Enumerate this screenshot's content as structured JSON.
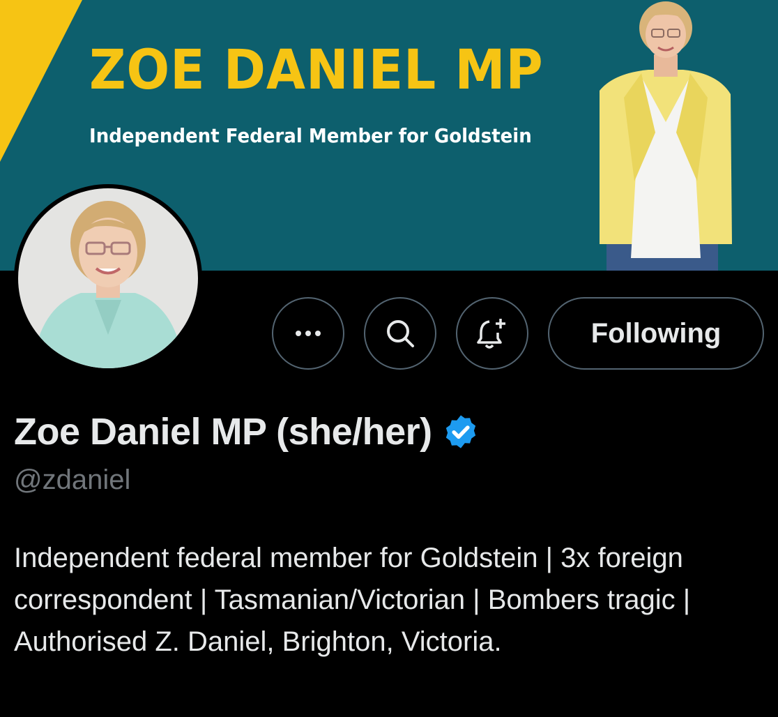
{
  "banner": {
    "title": "ZOE DANIEL MP",
    "subtitle": "Independent Federal Member for Goldstein",
    "background_color": "#0d5f6d",
    "accent_color": "#f6c414"
  },
  "actions": {
    "more_icon": "more-horizontal-icon",
    "search_icon": "search-icon",
    "notify_icon": "bell-plus-icon",
    "following_label": "Following"
  },
  "profile": {
    "display_name": "Zoe Daniel MP (she/her)",
    "verified_badge": "verified-badge-icon",
    "verified_color": "#1d9bf0",
    "handle": "@zdaniel",
    "bio": "Independent federal member for Goldstein | 3x foreign correspondent | Tasmanian/Victorian | Bombers tragic | Authorised Z. Daniel, Brighton, Victoria."
  }
}
